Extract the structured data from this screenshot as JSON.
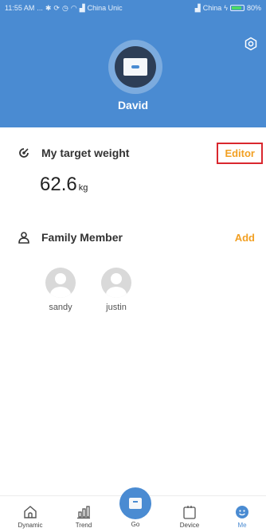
{
  "status_bar": {
    "time": "11:55 AM",
    "dots": "...",
    "carrier1": "China Unic",
    "carrier2": "China",
    "battery": "80%"
  },
  "header": {
    "user_name": "David",
    "settings_icon": "gear-icon"
  },
  "target": {
    "title": "My target weight",
    "action": "Editor",
    "value": "62.6",
    "unit": "kg"
  },
  "family": {
    "title": "Family Member",
    "action": "Add",
    "members": [
      {
        "name": "sandy"
      },
      {
        "name": "justin"
      }
    ]
  },
  "nav": {
    "items": [
      {
        "label": "Dynamic",
        "icon": "home-icon"
      },
      {
        "label": "Trend",
        "icon": "bar-chart-icon"
      },
      {
        "label": "Go",
        "icon": "scale-icon"
      },
      {
        "label": "Device",
        "icon": "device-icon"
      },
      {
        "label": "Me",
        "icon": "me-icon"
      }
    ],
    "active": "Me"
  },
  "colors": {
    "primary": "#4a8bd2",
    "accent": "#f2a023",
    "highlight_border": "#d9272e"
  }
}
